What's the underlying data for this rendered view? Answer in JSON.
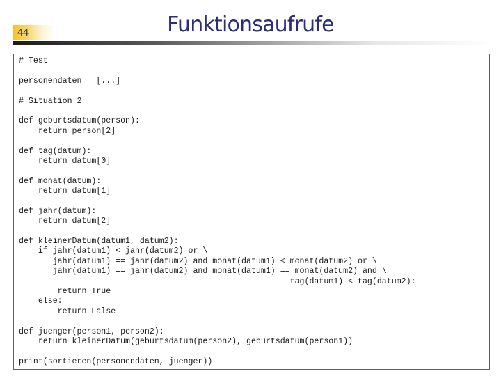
{
  "slide": {
    "number": "44",
    "title": "Funktionsaufrufe",
    "colors": {
      "title": "#2b2d7c",
      "accent_tab": "#f5c22a",
      "border": "#5e5e5e"
    }
  },
  "code": {
    "language": "python",
    "lines": [
      "# Test",
      "",
      "personendaten = [...]",
      "",
      "# Situation 2",
      "",
      "def geburtsdatum(person):",
      "    return person[2]",
      "",
      "def tag(datum):",
      "    return datum[0]",
      "",
      "def monat(datum):",
      "    return datum[1]",
      "",
      "def jahr(datum):",
      "    return datum[2]",
      "",
      "def kleinerDatum(datum1, datum2):",
      "    if jahr(datum1) < jahr(datum2) or \\",
      "       jahr(datum1) == jahr(datum2) and monat(datum1) < monat(datum2) or \\",
      "       jahr(datum1) == jahr(datum2) and monat(datum1) == monat(datum2) and \\",
      "                                                        tag(datum1) < tag(datum2):",
      "        return True",
      "    else:",
      "        return False",
      "",
      "def juenger(person1, person2):",
      "    return kleinerDatum(geburtsdatum(person2), geburtsdatum(person1))",
      "",
      "print(sortieren(personendaten, juenger))"
    ]
  }
}
